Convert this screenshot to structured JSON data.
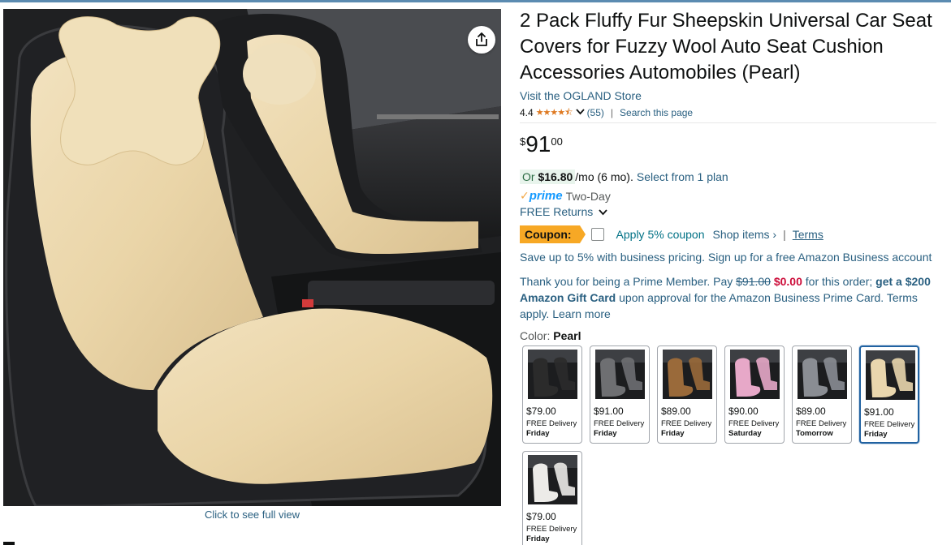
{
  "product": {
    "title": "2 Pack Fluffy Fur Sheepskin Universal Car Seat Covers for Fuzzy Wool Auto Seat Cushion Accessories Automobiles (Pearl)",
    "store_link": "Visit the OGLAND Store",
    "rating": "4.4",
    "rating_stars": "★★★★⯪",
    "rating_count": "(55)",
    "search_page": "Search this page",
    "full_view": "Click to see full view"
  },
  "price": {
    "symbol": "$",
    "whole": "91",
    "fraction": "00"
  },
  "monthly": {
    "or": "Or ",
    "amount": "$16.80",
    "per": "/mo (6 mo).",
    "plan": "Select from 1 plan"
  },
  "delivery": {
    "prime_check": "✓",
    "prime_word": "prime",
    "two_day": "Two-Day",
    "returns": "FREE Returns"
  },
  "coupon": {
    "badge": "Coupon:",
    "apply": "Apply 5% coupon",
    "shop_items": "Shop items ›",
    "separator": "|",
    "terms": "Terms"
  },
  "business": "Save up to 5% with business pricing. Sign up for a free Amazon Business account",
  "prime_member": {
    "p1": "Thank you for being a Prime Member. Pay ",
    "old_price": "$91.00",
    "new_price": "$0.00",
    "p2": " for this order; ",
    "gift": "get a $200 Amazon Gift Card",
    "p3": " upon approval for the Amazon Business Prime Card. Terms apply. Learn more"
  },
  "color": {
    "label": "Color: ",
    "value": "Pearl"
  },
  "swatches": [
    {
      "name": "black",
      "price": "$79.00",
      "delivery": "FREE Delivery",
      "day": "Friday",
      "fur": "#2b2b2b",
      "selected": false
    },
    {
      "name": "gray-black",
      "price": "$91.00",
      "delivery": "FREE Delivery",
      "day": "Friday",
      "fur": "#6e6f72",
      "selected": false
    },
    {
      "name": "brown",
      "price": "$89.00",
      "delivery": "FREE Delivery",
      "day": "Friday",
      "fur": "#9a6a3a",
      "selected": false
    },
    {
      "name": "pink",
      "price": "$90.00",
      "delivery": "FREE Delivery",
      "day": "Saturday",
      "fur": "#e7a8c8",
      "selected": false
    },
    {
      "name": "gray",
      "price": "$89.00",
      "delivery": "FREE Delivery",
      "day": "Tomorrow",
      "fur": "#8a8d93",
      "selected": false
    },
    {
      "name": "pearl",
      "price": "$91.00",
      "delivery": "FREE Delivery",
      "day": "Friday",
      "fur": "#e9d6ad",
      "selected": true
    },
    {
      "name": "white",
      "price": "$79.00",
      "delivery": "FREE Delivery",
      "day": "Friday",
      "fur": "#ecebe8",
      "selected": false
    }
  ],
  "colors": {
    "link": "#2a6081",
    "coupon": "#f7a825",
    "red_price": "#cc0c39",
    "prime_blue": "#1399ff",
    "selected_border": "#2162a1",
    "star": "#de7921"
  }
}
